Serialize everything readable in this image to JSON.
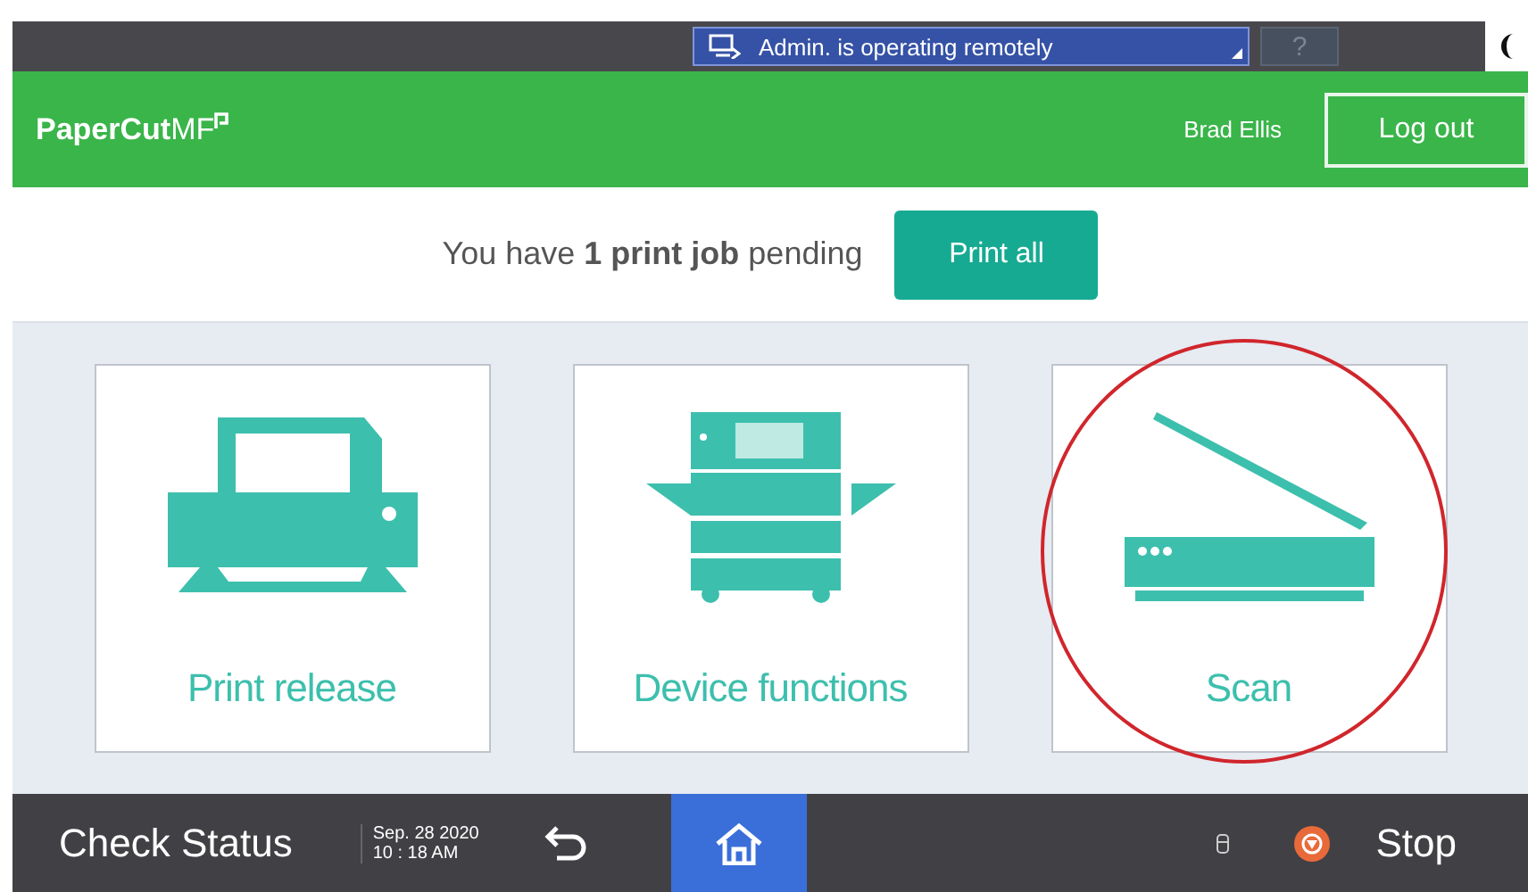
{
  "system_bar": {
    "remote_notice": "Admin. is operating remotely",
    "help": "?"
  },
  "header": {
    "logo": "PaperCut",
    "logo_suffix": "MF",
    "user": "Brad Ellis",
    "logout": "Log out"
  },
  "pending": {
    "message": "You have **1 print job** pending",
    "button": "Print all"
  },
  "tiles": [
    {
      "kind": "printer",
      "label": "Print release",
      "circled": false
    },
    {
      "kind": "copier",
      "label": "Device functions",
      "circled": false
    },
    {
      "kind": "scanner",
      "label": "Scan",
      "circled": true
    }
  ],
  "bottom_bar": {
    "check_status": "Check Status",
    "date": "Sep. 28 2020",
    "time": "10 : 18 AM",
    "home_selected": true,
    "stop": "Stop"
  }
}
